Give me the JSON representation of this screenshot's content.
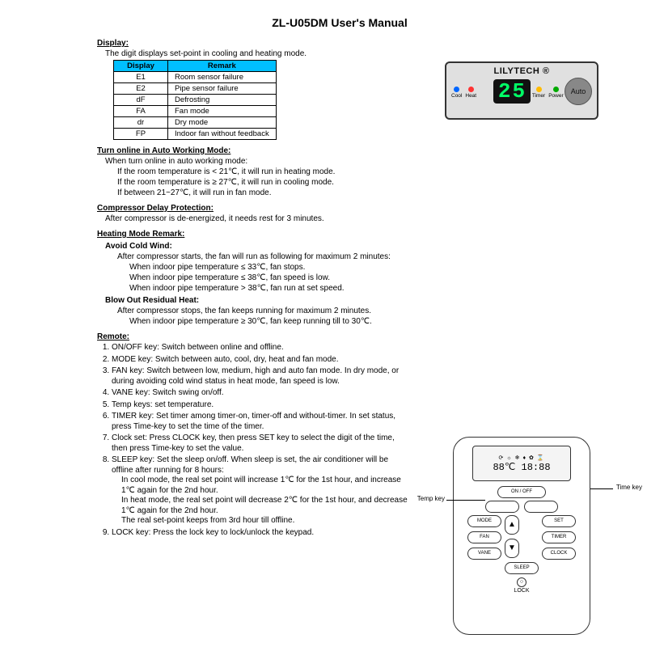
{
  "title": "ZL-U05DM User's Manual",
  "sections": {
    "display_heading": "Display:",
    "display_intro": "The digit displays set-point in cooling and heating mode.",
    "table_headers": {
      "c0": "Display",
      "c1": "Remark"
    },
    "table_rows": [
      {
        "code": "E1",
        "remark": "Room sensor failure"
      },
      {
        "code": "E2",
        "remark": "Pipe sensor failure"
      },
      {
        "code": "dF",
        "remark": "Defrosting"
      },
      {
        "code": "FA",
        "remark": "Fan mode"
      },
      {
        "code": "dr",
        "remark": "Dry mode"
      },
      {
        "code": "FP",
        "remark": "Indoor fan without feedback"
      }
    ],
    "auto_heading": "Turn online in Auto Working Mode:",
    "auto_lines": [
      "When turn online in auto working mode:",
      "If the room temperature is < 21℃, it will run in heating mode.",
      "If the room temperature is ≥ 27℃, it will run in cooling mode.",
      "If between 21~27℃, it will run in fan mode."
    ],
    "comp_heading": "Compressor Delay Protection:",
    "comp_line": "After compressor is de-energized, it needs rest for 3 minutes.",
    "heat_heading": "Heating Mode Remark:",
    "avoid_heading": "Avoid Cold Wind:",
    "avoid_lines": [
      "After compressor starts, the fan will run as following for maximum 2 minutes:",
      "When indoor pipe temperature ≤ 33℃, fan stops.",
      "When indoor pipe temperature ≤ 38℃, fan speed is low.",
      "When indoor pipe temperature > 38℃, fan run at set speed."
    ],
    "blow_heading": "Blow Out Residual Heat:",
    "blow_lines": [
      "After compressor stops, the fan keeps running for maximum 2 minutes.",
      "When indoor pipe temperature ≥ 30℃, fan keep running till to 30℃."
    ],
    "remote_heading": "Remote:",
    "remote_items": [
      "ON/OFF key: Switch between online and offline.",
      "MODE key: Switch between auto, cool, dry, heat and fan mode.",
      "FAN key: Switch between low, medium, high and auto fan mode. In dry mode, or during avoiding cold wind status in heat mode, fan speed is low.",
      "VANE key: Switch swing on/off.",
      "Temp keys: set temperature.",
      "TIMER key: Set timer among timer-on, timer-off and without-timer. In set status, press Time-key to set the time of the timer.",
      "Clock set: Press CLOCK key, then press SET key to select the digit of the time, then press Time-key to set the value.",
      "SLEEP key: Set the sleep on/off. When sleep is set, the air conditioner will be offline after running for 8 hours:",
      "LOCK key: Press the lock key to lock/unlock the keypad."
    ],
    "remote_sub_8": [
      "In cool mode, the real set point will increase 1℃ for the 1st hour, and increase 1℃ again for the 2nd hour.",
      "In heat mode, the real set point will decrease 2℃ for the 1st hour, and decrease 1℃ again for the 2nd hour.",
      "The real set-point keeps from 3rd hour till offline."
    ]
  },
  "panel": {
    "brand": "LILYTECH ®",
    "digits": "25",
    "auto": "Auto",
    "leds": [
      {
        "name": "Cool",
        "color": "#0066ff"
      },
      {
        "name": "Heat",
        "color": "#ff3333"
      },
      {
        "name": "Timer",
        "color": "#ffbb00"
      },
      {
        "name": "Power",
        "color": "#00aa00"
      }
    ]
  },
  "remote_fig": {
    "lcd_icons": "⟳ ☼ ❄ ♦ ✿ ⌛",
    "lcd_reading": "88℃ 18:88",
    "onoff": "ON / OFF",
    "mode": "MODE",
    "set": "SET",
    "fan": "FAN",
    "timer": "TIMER",
    "vane": "VANE",
    "sleep": "SLEEP",
    "clock": "CLOCK",
    "up": "▲",
    "down": "▼",
    "lock_icon": "○",
    "lock_label": "LOCK",
    "callout_temp": "Temp key",
    "callout_time": "Time key"
  }
}
